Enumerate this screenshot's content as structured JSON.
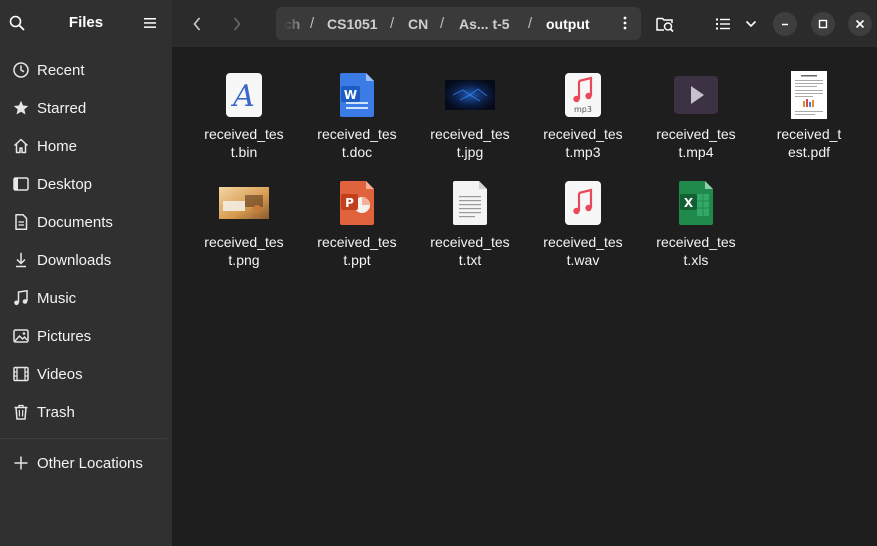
{
  "app": {
    "title": "Files"
  },
  "sidebar": {
    "items": [
      {
        "label": "Recent",
        "icon": "clock-icon"
      },
      {
        "label": "Starred",
        "icon": "star-icon"
      },
      {
        "label": "Home",
        "icon": "home-icon"
      },
      {
        "label": "Desktop",
        "icon": "desktop-icon"
      },
      {
        "label": "Documents",
        "icon": "document-icon"
      },
      {
        "label": "Downloads",
        "icon": "download-icon"
      },
      {
        "label": "Music",
        "icon": "music-icon"
      },
      {
        "label": "Pictures",
        "icon": "picture-icon"
      },
      {
        "label": "Videos",
        "icon": "video-icon"
      },
      {
        "label": "Trash",
        "icon": "trash-icon"
      }
    ],
    "other_locations": "Other Locations"
  },
  "path": {
    "crumbs": [
      "ech",
      "CS1051",
      "CN",
      "As... t-5",
      "output"
    ]
  },
  "files": {
    "items": [
      {
        "name_line1": "received_tes",
        "name_line2": "t.bin",
        "type": "bin"
      },
      {
        "name_line1": "received_tes",
        "name_line2": "t.doc",
        "type": "doc"
      },
      {
        "name_line1": "received_tes",
        "name_line2": "t.jpg",
        "type": "jpg"
      },
      {
        "name_line1": "received_tes",
        "name_line2": "t.mp3",
        "type": "mp3",
        "badge": "mp3"
      },
      {
        "name_line1": "received_tes",
        "name_line2": "t.mp4",
        "type": "mp4"
      },
      {
        "name_line1": "received_t",
        "name_line2": "est.pdf",
        "type": "pdf"
      },
      {
        "name_line1": "received_tes",
        "name_line2": "t.png",
        "type": "png"
      },
      {
        "name_line1": "received_tes",
        "name_line2": "t.ppt",
        "type": "ppt"
      },
      {
        "name_line1": "received_tes",
        "name_line2": "t.txt",
        "type": "txt"
      },
      {
        "name_line1": "received_tes",
        "name_line2": "t.wav",
        "type": "wav"
      },
      {
        "name_line1": "received_tes",
        "name_line2": "t.xls",
        "type": "xls"
      }
    ]
  },
  "colors": {
    "sidebar_bg": "#303030",
    "header_bg": "#2b2b2b",
    "content_bg": "#1e1e1e",
    "doc_blue": "#2f6fd6",
    "ppt_orange": "#d9532c",
    "xls_green": "#1f8a4c",
    "audio_red": "#e9485b"
  }
}
